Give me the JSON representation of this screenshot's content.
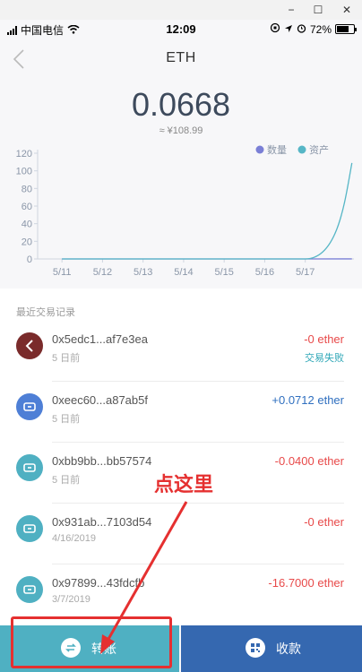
{
  "window": {
    "minimize": "−",
    "maximize": "☐",
    "close": "✕"
  },
  "status_bar": {
    "carrier": "中国电信",
    "time": "12:09",
    "battery_text": "72%",
    "battery_level": 0.72
  },
  "nav": {
    "title": "ETH"
  },
  "balance": {
    "amount": "0.0668",
    "fiat": "≈ ¥108.99"
  },
  "chart_data": {
    "type": "line",
    "legend": [
      {
        "name": "数量",
        "color": "#7a7fd6"
      },
      {
        "name": "资产",
        "color": "#56b6c6"
      }
    ],
    "legend_position": "top-right",
    "categories": [
      "5/11",
      "5/12",
      "5/13",
      "5/14",
      "5/15",
      "5/16",
      "5/17"
    ],
    "y_ticks": [
      "0",
      "20",
      "40",
      "60",
      "80",
      "100",
      "120"
    ],
    "ylim": [
      0,
      120
    ],
    "series": [
      {
        "name": "数量",
        "values": [
          0,
          0,
          0,
          0,
          0,
          0,
          0,
          0.0668
        ]
      },
      {
        "name": "资产",
        "values": [
          0,
          0,
          0,
          0,
          0,
          0,
          0,
          108.99
        ]
      }
    ]
  },
  "history": {
    "title": "最近交易记录",
    "items": [
      {
        "address": "0x5edc1...af7e3ea",
        "date": "5 日前",
        "amount": "-0 ether",
        "status": "交易失败",
        "type": "failed"
      },
      {
        "address": "0xeec60...a87ab5f",
        "date": "5 日前",
        "amount": "+0.0712 ether",
        "status": "",
        "type": "in"
      },
      {
        "address": "0xbb9bb...bb57574",
        "date": "5 日前",
        "amount": "-0.0400 ether",
        "status": "",
        "type": "out"
      },
      {
        "address": "0x931ab...7103d54",
        "date": "4/16/2019",
        "amount": "-0 ether",
        "status": "",
        "type": "out"
      },
      {
        "address": "0x97899...43fdcfb",
        "date": "3/7/2019",
        "amount": "-16.7000 ether",
        "status": "",
        "type": "out"
      }
    ]
  },
  "actions": {
    "transfer": "转账",
    "receive": "收款"
  },
  "annotation": {
    "text": "点这里",
    "color": "#e53030"
  }
}
